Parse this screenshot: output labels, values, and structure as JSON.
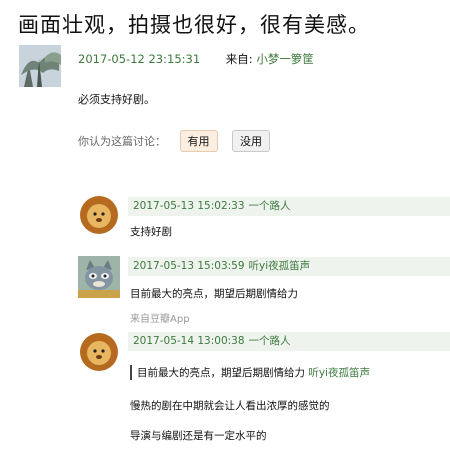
{
  "title": "画面壮观，拍摄也很好，很有美感。",
  "post": {
    "time": "2017-05-12 23:15:31",
    "from_prefix": "来自: ",
    "from_user": "小梦一箩筐",
    "body": "必须支持好剧。",
    "vote_label": "你认为这篇讨论：",
    "useful_label": "有用",
    "useless_label": "没用"
  },
  "replies": [
    {
      "avatar": "lion-avatar",
      "time": "2017-05-13 15:02:33",
      "user": "一个路人",
      "text": "支持好剧"
    },
    {
      "avatar": "cat-avatar",
      "time": "2017-05-13 15:03:59",
      "user": "听yi夜孤笛声",
      "text": "目前最大的亮点，期望后期剧情给力",
      "client": "来自豆瓣App"
    },
    {
      "avatar": "lion-avatar",
      "time": "2017-05-14 13:00:38",
      "user": "一个路人",
      "quote_text": "目前最大的亮点，期望后期剧情给力",
      "quote_user": "听yi夜孤笛声",
      "line1": "慢热的剧在中期就会让人看出浓厚的感觉的",
      "line2": "导演与编剧还是有一定水平的"
    }
  ]
}
